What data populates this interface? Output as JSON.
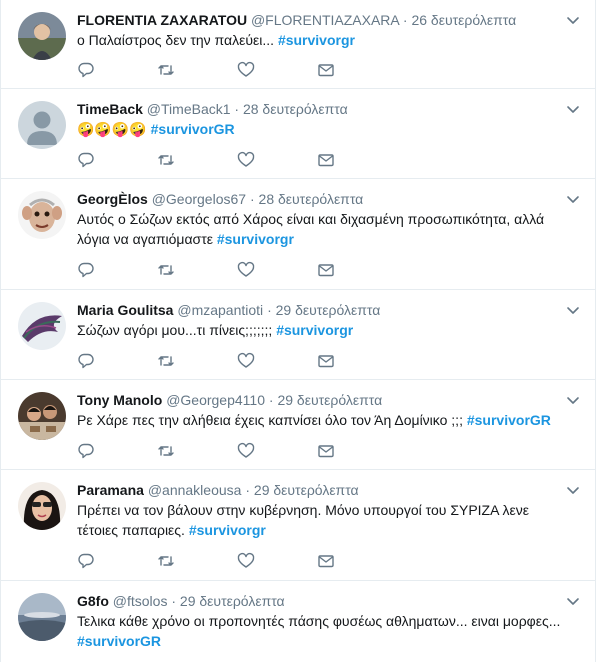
{
  "tweets": [
    {
      "name": "FLORENTIA ZAXARATOU",
      "handle": "@FLORENTIAZAXARA",
      "dot": "·",
      "time": "26 δευτερόλεπτα",
      "text": "ο Παλαίστρος δεν την παλεύει...",
      "hashtag": "#survivorgr",
      "avatar": "photo-avatar"
    },
    {
      "name": "TimeBack",
      "handle": "@TimeBack1",
      "dot": "·",
      "time": "28 δευτερόλεπτα",
      "text": "🤪🤪🤪🤪",
      "hashtag": "#survivorGR",
      "avatar": "default-avatar"
    },
    {
      "name": "GeorgÈlos",
      "handle": "@Georgelos67",
      "dot": "·",
      "time": "28 δευτερόλεπτα",
      "text": "Αυτός ο Σώζων εκτός από Χάρος είναι και διχασμένη προσωπικότητα, αλλά λόγια να αγαπιόμαστε",
      "hashtag": "#survivorgr",
      "avatar": "troll-avatar"
    },
    {
      "name": "Maria Goulitsa",
      "handle": "@mzapantioti",
      "dot": "·",
      "time": "29 δευτερόλεπτα",
      "text": "Σώζων αγόρι μου...τι πίνεις;;;;;;;",
      "hashtag": "#survivorgr",
      "avatar": "feather-avatar"
    },
    {
      "name": "Tony Manolo",
      "handle": "@Georgep4110",
      "dot": "·",
      "time": "29 δευτερόλεπτα",
      "text": "Ρε Χάρε πες την αλήθεια έχεις καπνίσει όλο τον Άη Δομίνικο ;;;",
      "hashtag": "#survivorGR",
      "avatar": "photo-avatar"
    },
    {
      "name": "Paramana",
      "handle": "@annakleousa",
      "dot": "·",
      "time": "29 δευτερόλεπτα",
      "text": "Πρέπει να τον βάλουν στην κυβέρνηση. Μόνο υπουργοί του ΣΥΡΙΖΑ λενε τέτοιες παπαριες.",
      "hashtag": "#survivorgr",
      "avatar": "woman-avatar"
    },
    {
      "name": "G8fo",
      "handle": "@ftsolos",
      "dot": "·",
      "time": "29 δευτερόλεπτα",
      "text": "Τελικα κάθε χρόνο οι προπονητές πάσης φυσέως αθληματων... ειναι μορφες...",
      "hashtag": "#survivorGR",
      "avatar": "landscape-avatar"
    }
  ],
  "icons": {
    "reply": "reply-icon",
    "retweet": "retweet-icon",
    "like": "heart-icon",
    "message": "envelope-icon",
    "caret": "chevron-down-icon"
  },
  "colors": {
    "hashtag": "#1b95e0",
    "meta": "#657786",
    "icon": "#657786",
    "divider": "#e6ecf0"
  }
}
